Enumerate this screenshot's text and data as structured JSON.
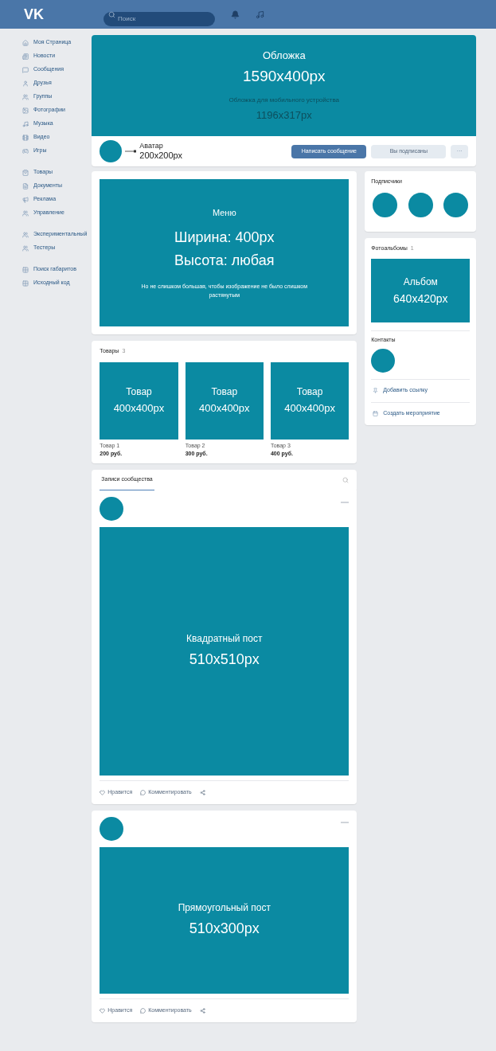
{
  "header": {
    "logo": "VK",
    "search": {
      "placeholder": "Поиск"
    }
  },
  "sidebar": {
    "groups": [
      [
        {
          "label": "Моя Страница"
        },
        {
          "label": "Новости"
        },
        {
          "label": "Сообщения"
        },
        {
          "label": "Друзья"
        },
        {
          "label": "Группы"
        },
        {
          "label": "Фотографии"
        },
        {
          "label": "Музыка"
        },
        {
          "label": "Видео"
        },
        {
          "label": "Игры"
        }
      ],
      [
        {
          "label": "Товары"
        },
        {
          "label": "Документы"
        },
        {
          "label": "Реклама"
        },
        {
          "label": "Управление"
        }
      ],
      [
        {
          "label": "Экспериментальный"
        },
        {
          "label": "Тестеры"
        }
      ],
      [
        {
          "label": "Поиск габаритов"
        },
        {
          "label": "Исходный код"
        }
      ]
    ]
  },
  "cover": {
    "title": "Обложка",
    "size": "1590x400px",
    "mobile_title": "Обложка для мобильного устройства",
    "mobile_size": "1196x317px"
  },
  "profile": {
    "avatar_label": "Аватар",
    "avatar_size": "200x200px",
    "buttons": [
      {
        "label": "Написать сообщение",
        "kind": "primary"
      },
      {
        "label": "Вы подписаны",
        "kind": "secondary"
      },
      {
        "label": "···",
        "kind": "more"
      }
    ]
  },
  "menu_card": {
    "title": "Меню",
    "width": "Ширина: 400px",
    "height": "Высота: любая",
    "note": "Но не слишком большая, чтобы изображение не было слишком растянутым"
  },
  "goods": {
    "title": "Товары",
    "count": "3",
    "items": [
      {
        "image_title": "Товар",
        "image_size": "400x400px",
        "name": "Товар 1",
        "price": "200 руб."
      },
      {
        "image_title": "Товар",
        "image_size": "400x400px",
        "name": "Товар 2",
        "price": "300 руб."
      },
      {
        "image_title": "Товар",
        "image_size": "400x400px",
        "name": "Товар 3",
        "price": "400 руб."
      }
    ]
  },
  "wall": {
    "tabs": [
      {
        "label": "Записи сообщества",
        "selected": true
      }
    ],
    "posts": [
      {
        "image_title": "Квадратный пост",
        "image_size": "510x510px",
        "kind": "square",
        "actions": [
          "Нравится",
          "Комментировать"
        ]
      },
      {
        "image_title": "Прямоугольный пост",
        "image_size": "510x300px",
        "kind": "wide",
        "actions": [
          "Нравится",
          "Комментировать"
        ]
      }
    ]
  },
  "followers": {
    "title": "Подписчики"
  },
  "albums": {
    "title": "Фотоальбомы",
    "count": "1",
    "album_title": "Альбом",
    "album_size": "640x420px"
  },
  "contacts": {
    "title": "Контакты",
    "links": [
      {
        "label": "Добавить ссылку"
      },
      {
        "label": "Создать мероприятие"
      }
    ]
  }
}
